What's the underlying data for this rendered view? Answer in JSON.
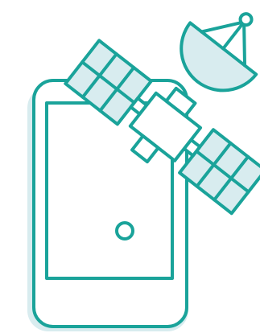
{
  "illustration": {
    "icons": [
      "smartphone-icon",
      "satellite-icon",
      "satellite-dish-icon",
      "solar-panel-icon",
      "home-button-icon"
    ],
    "colors": {
      "stroke": "#1aa39a",
      "fill_light": "#d8ecef",
      "fill_white": "#ffffff",
      "background": "#ffffff"
    }
  }
}
